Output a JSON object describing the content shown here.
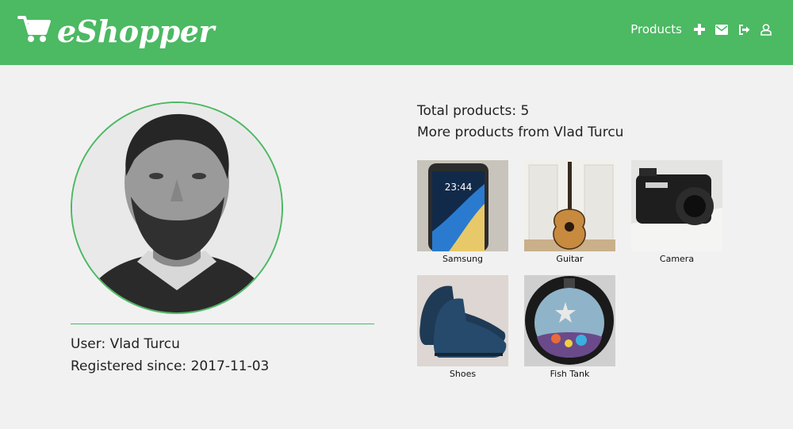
{
  "header": {
    "brand": "eShopper",
    "nav_products": "Products",
    "icons": [
      "cart-icon",
      "plus-icon",
      "envelope-icon",
      "sign-out-icon",
      "user-icon"
    ],
    "color": "#4cb963"
  },
  "profile": {
    "user_label": "User: Vlad Turcu",
    "registered_label": "Registered since: 2017-11-03"
  },
  "products_panel": {
    "total": "Total products: 5",
    "more": "More products from Vlad Turcu",
    "items": [
      {
        "name": "Samsung"
      },
      {
        "name": "Guitar"
      },
      {
        "name": "Camera"
      },
      {
        "name": "Shoes"
      },
      {
        "name": "Fish Tank"
      }
    ]
  }
}
